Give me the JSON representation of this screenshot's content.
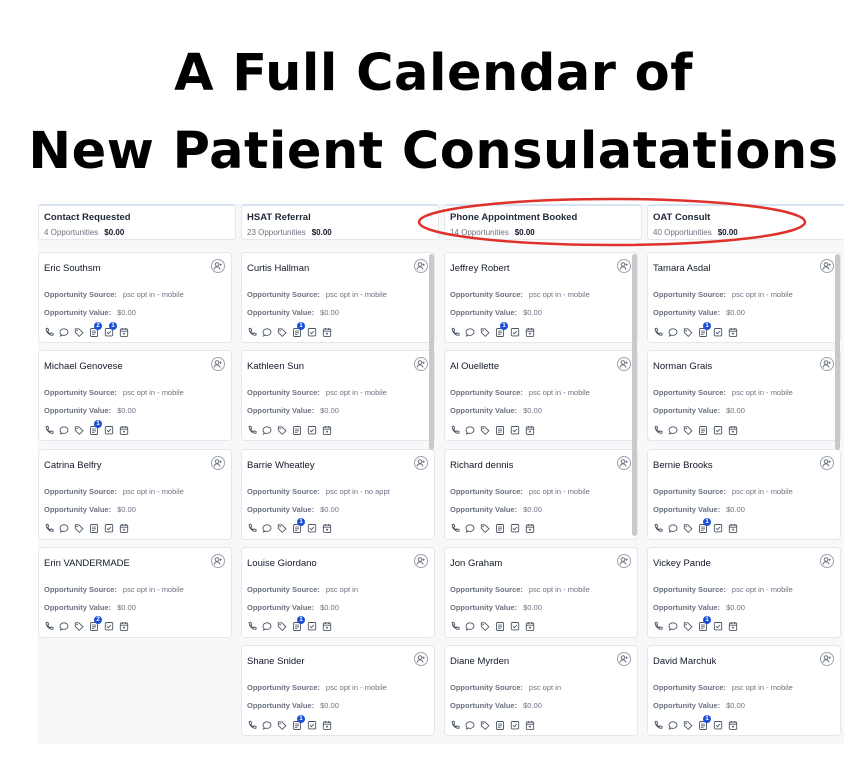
{
  "headline": {
    "line1": "A Full Calendar of",
    "line2": "New Patient Consulatations"
  },
  "colors": {
    "highlight": "#e0302a",
    "badge": "#1d4ed8",
    "board_bg": "#f7f8fa"
  },
  "field_labels": {
    "source": "Opportunity Source:",
    "value": "Opportunity Value:"
  },
  "card_icons": [
    "phone-icon",
    "chat-icon",
    "tag-icon",
    "notes-icon",
    "task-icon",
    "calendar-icon"
  ],
  "columns": [
    {
      "title": "Contact Requested",
      "count": "4 Opportunities",
      "amount": "$0.00",
      "cards": [
        {
          "name": "Eric Southsm",
          "source": "psc opt in - mobile",
          "value": "$0.00",
          "notes_badge": "2",
          "tasks_badge": "1"
        },
        {
          "name": "Michael Genovese",
          "source": "psc opt in - mobile",
          "value": "$0.00",
          "notes_badge": "1",
          "tasks_badge": ""
        },
        {
          "name": "Catrina Belfry",
          "source": "psc opt in - mobile",
          "value": "$0.00",
          "notes_badge": "",
          "tasks_badge": ""
        },
        {
          "name": "Erin VANDERMADE",
          "source": "psc opt in - mobile",
          "value": "$0.00",
          "notes_badge": "2",
          "tasks_badge": ""
        }
      ]
    },
    {
      "title": "HSAT Referral",
      "count": "23 Opportunities",
      "amount": "$0.00",
      "cards": [
        {
          "name": "Curtis Hallman",
          "source": "psc opt in - mobile",
          "value": "$0.00",
          "notes_badge": "1",
          "tasks_badge": ""
        },
        {
          "name": "Kathleen Sun",
          "source": "psc opt in - mobile",
          "value": "$0.00",
          "notes_badge": "",
          "tasks_badge": ""
        },
        {
          "name": "Barrie Wheatley",
          "source": "psc opt in - no appt",
          "value": "$0.00",
          "notes_badge": "1",
          "tasks_badge": ""
        },
        {
          "name": "Louise Giordano",
          "source": "psc opt in",
          "value": "$0.00",
          "notes_badge": "1",
          "tasks_badge": ""
        },
        {
          "name": "Shane Snider",
          "source": "psc opt in - mobile",
          "value": "$0.00",
          "notes_badge": "1",
          "tasks_badge": ""
        }
      ]
    },
    {
      "title": "Phone Appointment Booked",
      "count": "14 Opportunities",
      "amount": "$0.00",
      "cards": [
        {
          "name": "Jeffrey Robert",
          "source": "psc opt in - mobile",
          "value": "$0.00",
          "notes_badge": "1",
          "tasks_badge": ""
        },
        {
          "name": "Al Ouellette",
          "source": "psc opt in - mobile",
          "value": "$0.00",
          "notes_badge": "",
          "tasks_badge": ""
        },
        {
          "name": "Richard dennis",
          "source": "psc opt in - mobile",
          "value": "$0.00",
          "notes_badge": "",
          "tasks_badge": ""
        },
        {
          "name": "Jon Graham",
          "source": "psc opt in - mobile",
          "value": "$0.00",
          "notes_badge": "",
          "tasks_badge": ""
        },
        {
          "name": "Diane Myrden",
          "source": "psc opt in",
          "value": "$0.00",
          "notes_badge": "",
          "tasks_badge": ""
        }
      ]
    },
    {
      "title": "OAT Consult",
      "count": "40 Opportunities",
      "amount": "$0.00",
      "cards": [
        {
          "name": "Tamara Asdal",
          "source": "psc opt in - mobile",
          "value": "$0.00",
          "notes_badge": "1",
          "tasks_badge": ""
        },
        {
          "name": "Norman Grais",
          "source": "psc opt in - mobile",
          "value": "$0.00",
          "notes_badge": "",
          "tasks_badge": ""
        },
        {
          "name": "Bernie Brooks",
          "source": "psc opt in - mobile",
          "value": "$0.00",
          "notes_badge": "1",
          "tasks_badge": ""
        },
        {
          "name": "Vickey Pande",
          "source": "psc opt in - mobile",
          "value": "$0.00",
          "notes_badge": "1",
          "tasks_badge": ""
        },
        {
          "name": "David Marchuk",
          "source": "psc opt in - mobile",
          "value": "$0.00",
          "notes_badge": "1",
          "tasks_badge": ""
        }
      ]
    }
  ]
}
